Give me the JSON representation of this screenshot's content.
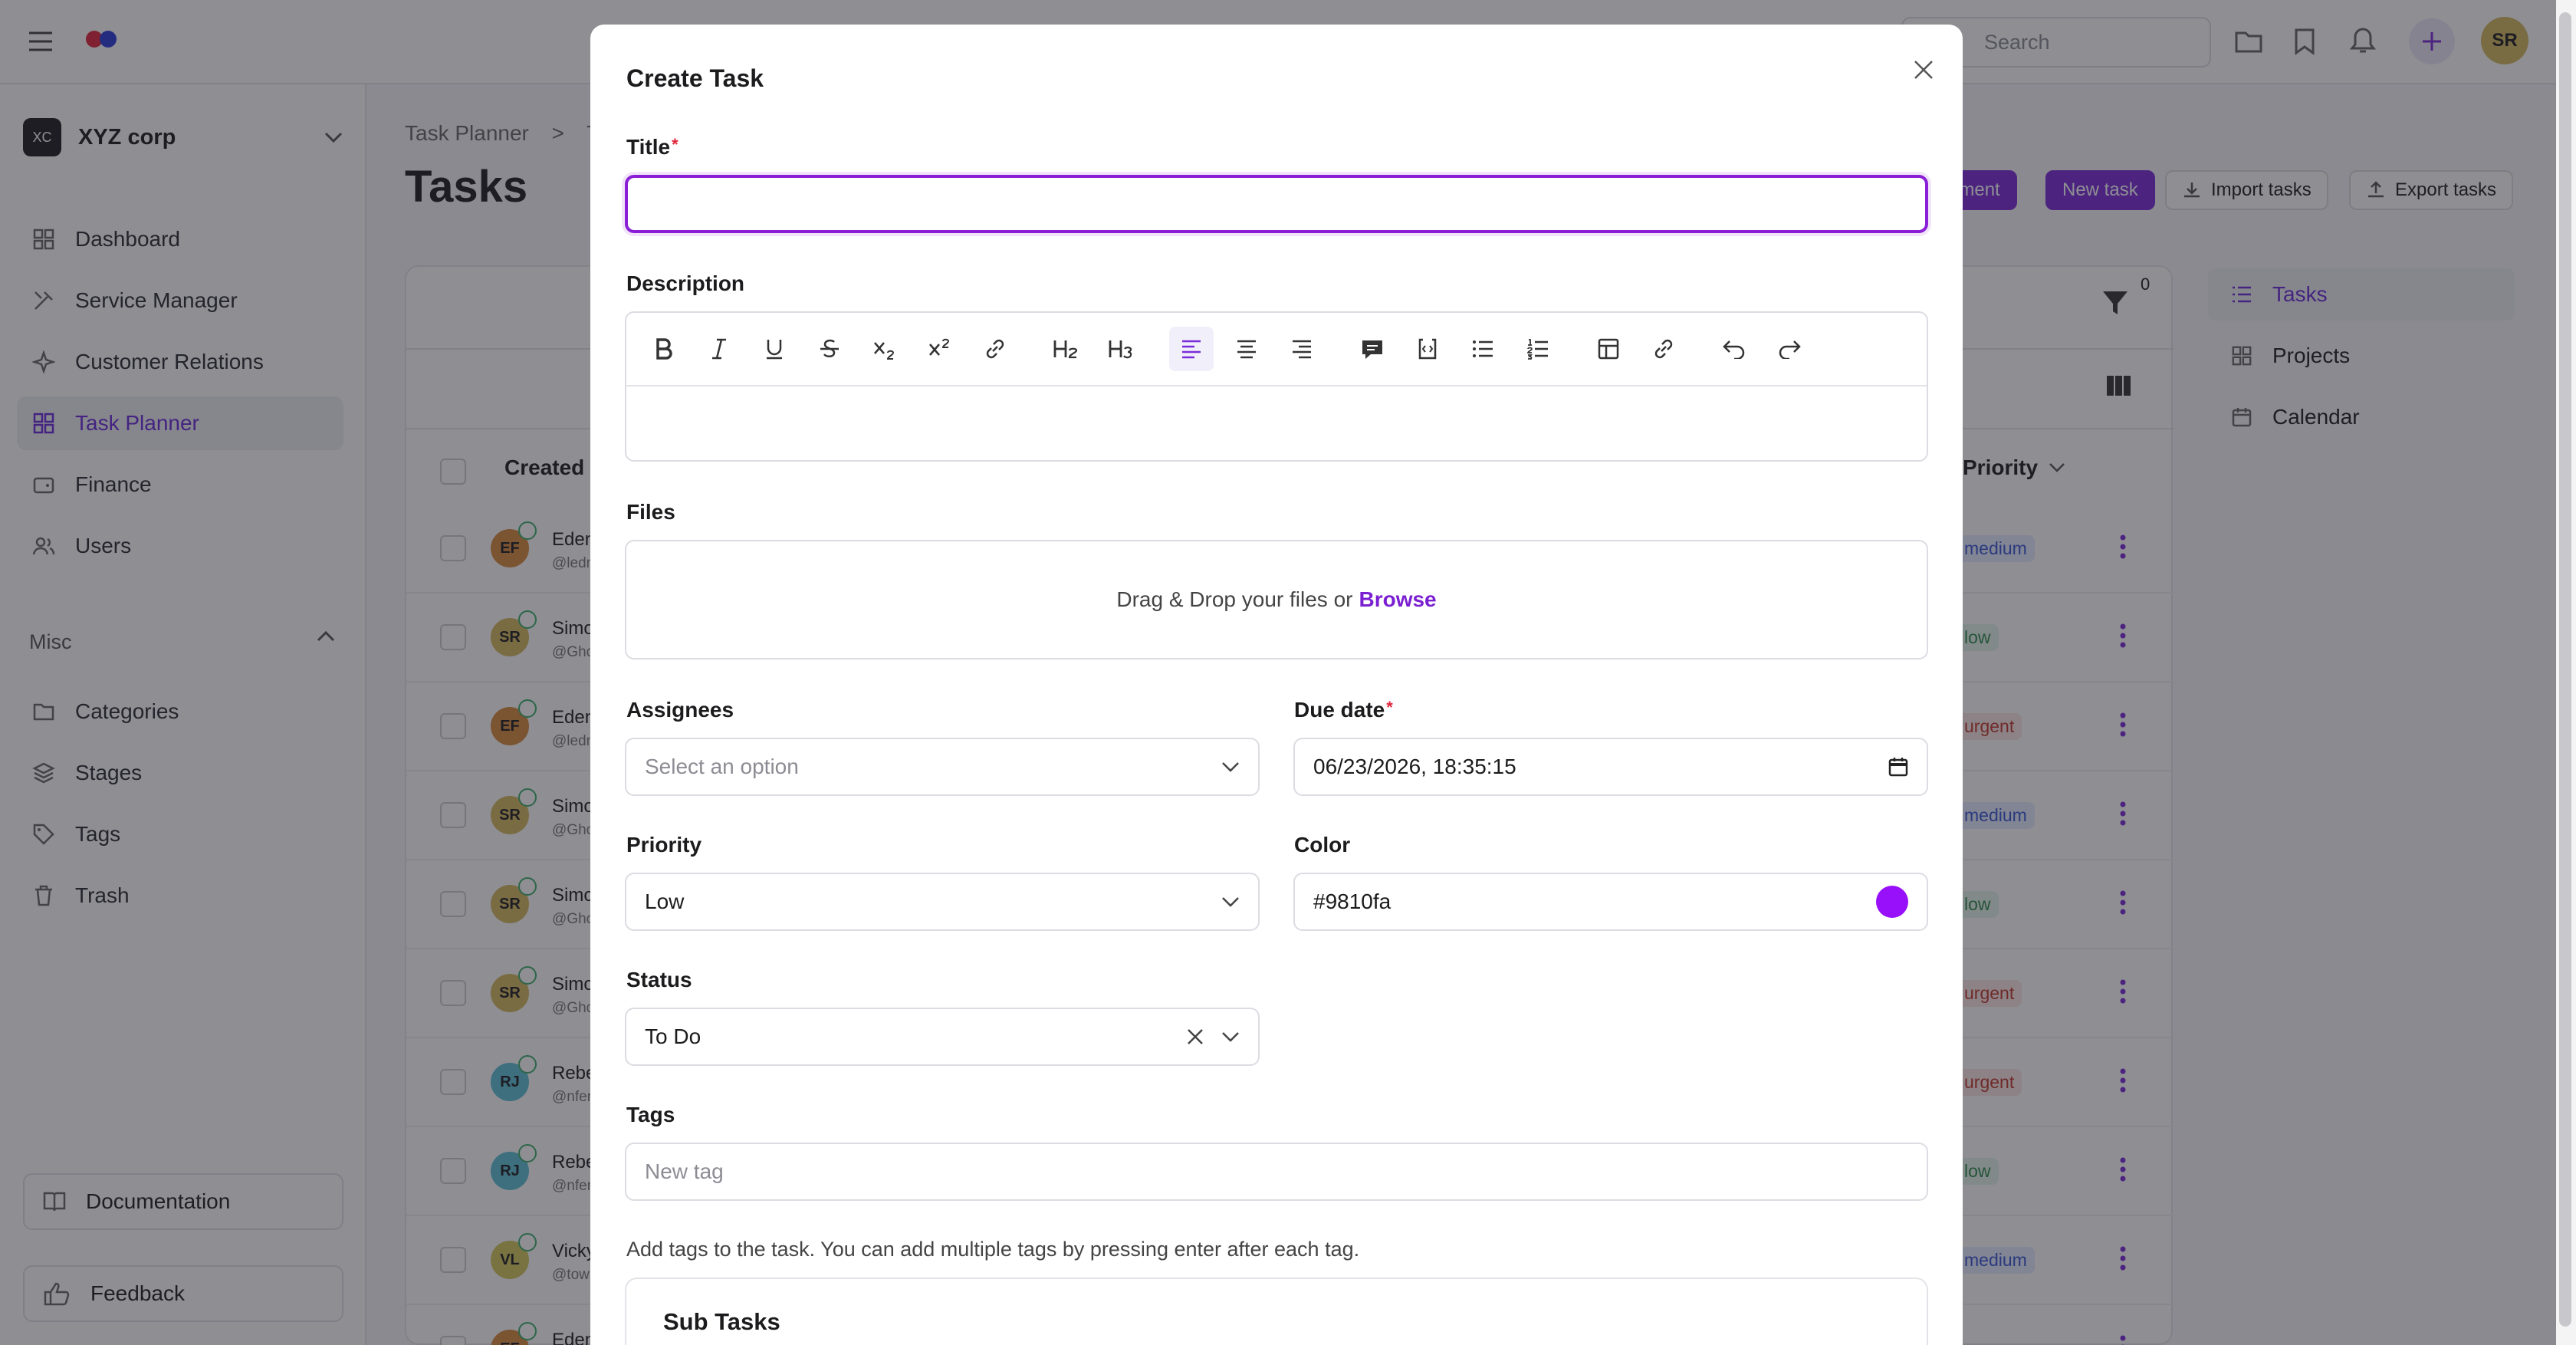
{
  "topbar": {
    "search_placeholder": "Search",
    "user_initials": "SR"
  },
  "sidebar": {
    "org": {
      "logo": "XC",
      "name": "XYZ corp"
    },
    "items": [
      {
        "label": "Dashboard",
        "icon": "grid-icon"
      },
      {
        "label": "Service Manager",
        "icon": "tools-icon"
      },
      {
        "label": "Customer Relations",
        "icon": "sparkle-icon"
      },
      {
        "label": "Task Planner",
        "icon": "grid-icon",
        "active": true
      },
      {
        "label": "Finance",
        "icon": "wallet-icon"
      },
      {
        "label": "Users",
        "icon": "users-icon"
      }
    ],
    "misc_label": "Misc",
    "misc_items": [
      {
        "label": "Categories",
        "icon": "folder-icon"
      },
      {
        "label": "Stages",
        "icon": "layers-icon"
      },
      {
        "label": "Tags",
        "icon": "tag-icon"
      },
      {
        "label": "Trash",
        "icon": "trash-icon"
      }
    ],
    "documentation": "Documentation",
    "feedback": "Feedback"
  },
  "main": {
    "breadcrumb": {
      "root": "Task Planner",
      "sep": ">",
      "current": "T"
    },
    "title": "Tasks",
    "buttons": {
      "management": "ement",
      "new_task": "New task",
      "import": "Import tasks",
      "export": "Export tasks"
    },
    "filter_count": "0",
    "columns": {
      "created": "Created",
      "priority": "Priority"
    },
    "rows": [
      {
        "initials": "EF",
        "name": "Eden",
        "handle": "@ledn",
        "avatar_color": "#d98a3c",
        "priority": "medium"
      },
      {
        "initials": "SR",
        "name": "Simo",
        "handle": "@Gho",
        "avatar_color": "#d4b85c",
        "priority": "low"
      },
      {
        "initials": "EF",
        "name": "Eden",
        "handle": "@ledn",
        "avatar_color": "#d98a3c",
        "priority": "urgent"
      },
      {
        "initials": "SR",
        "name": "Simo",
        "handle": "@Gho",
        "avatar_color": "#d4b85c",
        "priority": "medium"
      },
      {
        "initials": "SR",
        "name": "Simo",
        "handle": "@Gho",
        "avatar_color": "#d4b85c",
        "priority": "low"
      },
      {
        "initials": "SR",
        "name": "Simo",
        "handle": "@Gho",
        "avatar_color": "#d4b85c",
        "priority": "urgent"
      },
      {
        "initials": "RJ",
        "name": "Rebe",
        "handle": "@nfer",
        "avatar_color": "#5cc0d4",
        "priority": "urgent"
      },
      {
        "initials": "RJ",
        "name": "Rebe",
        "handle": "@nfer",
        "avatar_color": "#5cc0d4",
        "priority": "low"
      },
      {
        "initials": "VL",
        "name": "Vicky",
        "handle": "@tow",
        "avatar_color": "#d4c85c",
        "priority": "medium"
      },
      {
        "initials": "EF",
        "name": "Eden",
        "handle": "",
        "avatar_color": "#d98a3c",
        "priority": ""
      }
    ]
  },
  "right_nav": [
    {
      "label": "Tasks",
      "icon": "list-icon",
      "active": true
    },
    {
      "label": "Projects",
      "icon": "grid-icon"
    },
    {
      "label": "Calendar",
      "icon": "calendar-icon"
    }
  ],
  "modal": {
    "title": "Create Task",
    "title_label": "Title",
    "title_value": "",
    "description_label": "Description",
    "files_label": "Files",
    "dropzone_text": "Drag & Drop your files or",
    "browse": "Browse",
    "assignees_label": "Assignees",
    "assignees_placeholder": "Select an option",
    "due_label": "Due date",
    "due_value": "06/23/2026, 18:35:15",
    "priority_label": "Priority",
    "priority_value": "Low",
    "color_label": "Color",
    "color_value": "#9810fa",
    "status_label": "Status",
    "status_value": "To Do",
    "tags_label": "Tags",
    "tags_placeholder": "New tag",
    "tags_help": "Add tags to the task. You can add multiple tags by pressing enter after each tag.",
    "subtasks_title": "Sub Tasks",
    "required_mark": "*"
  },
  "colors": {
    "accent": "#8a1fd6",
    "color_swatch": "#9810fa"
  }
}
